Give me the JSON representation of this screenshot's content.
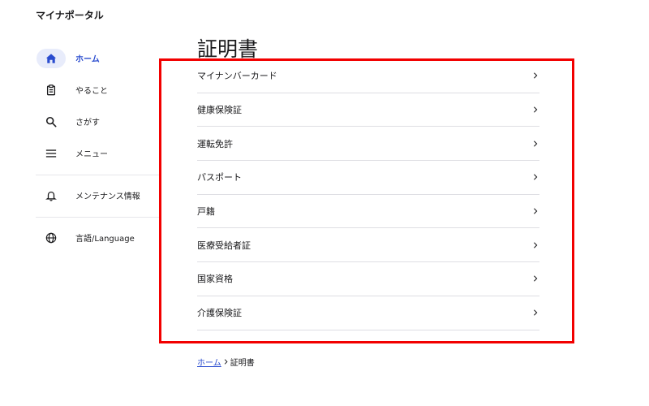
{
  "app": {
    "title": "マイナポータル"
  },
  "sidebar": {
    "items": [
      {
        "label": "ホーム",
        "icon": "home-icon",
        "active": true
      },
      {
        "label": "やること",
        "icon": "clipboard-icon"
      },
      {
        "label": "さがす",
        "icon": "search-icon"
      },
      {
        "label": "メニュー",
        "icon": "menu-icon"
      },
      {
        "label": "メンテナンス情報",
        "icon": "bell-icon"
      },
      {
        "label": "言語/Language",
        "icon": "globe-icon"
      }
    ]
  },
  "main": {
    "title": "証明書",
    "items": [
      {
        "label": "マイナンバーカード"
      },
      {
        "label": "健康保険証"
      },
      {
        "label": "運転免許"
      },
      {
        "label": "パスポート"
      },
      {
        "label": "戸籍"
      },
      {
        "label": "医療受給者証"
      },
      {
        "label": "国家資格"
      },
      {
        "label": "介護保険証"
      }
    ]
  },
  "breadcrumb": {
    "home": "ホーム",
    "current": "証明書"
  },
  "colors": {
    "accent": "#2a4ccf",
    "highlight": "#f20000",
    "active_bg": "#e8ecfb"
  }
}
